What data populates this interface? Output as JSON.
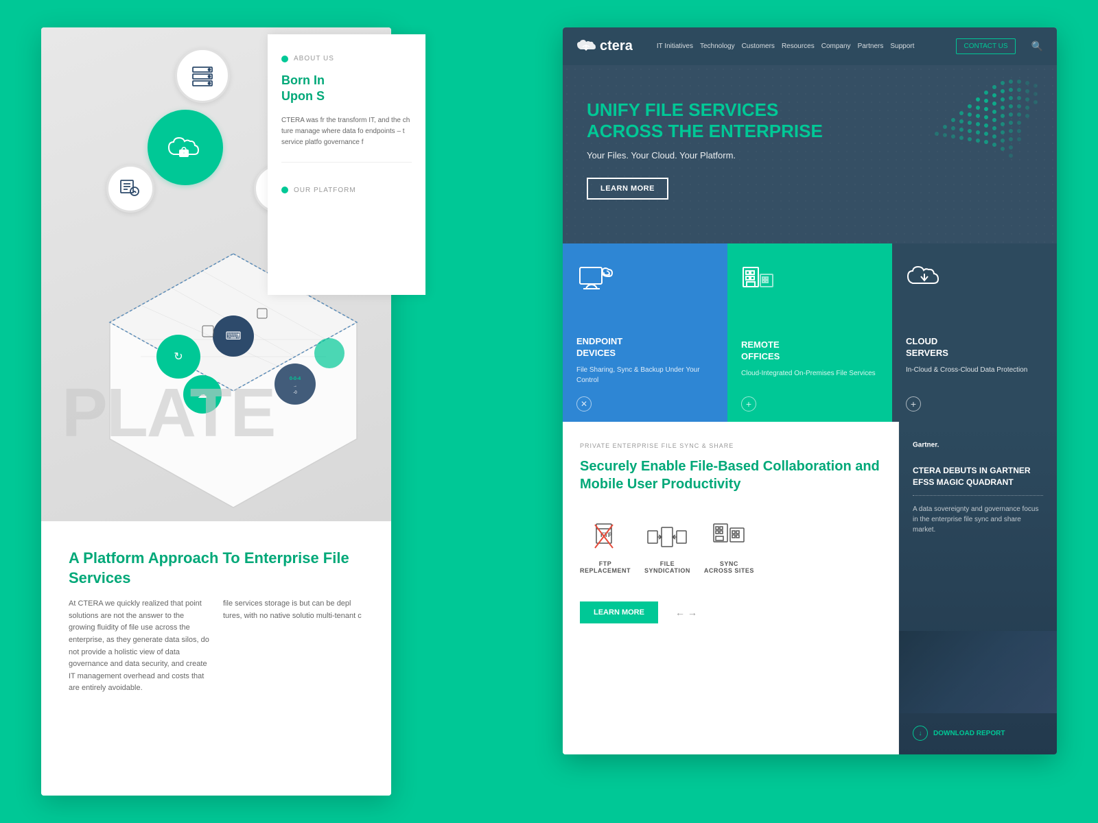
{
  "background": {
    "color": "#00c896"
  },
  "left_panel": {
    "platform_word": "PLATE",
    "bottom_heading": "A Platform Approach To Enterprise File Services",
    "bottom_text1": "At CTERA we quickly realized that point solutions are not the answer to the growing fluidity of file use across the enterprise, as they generate data silos, do not provide a holistic view of data governance and data security, and create IT management overhead and costs that are entirely avoidable.",
    "bottom_text2": "file services storage is but can be depl tures, with no native solutio multi-tenant c"
  },
  "about_panel": {
    "label": "ABOUT US",
    "heading_line1": "Born In",
    "heading_line2": "Upon S",
    "body_text": "CTERA was fr the transform IT, and the ch ture manage where data fo endpoints – t service platfo governance f"
  },
  "nav": {
    "logo": "ctera",
    "links": [
      "IT Initiatives",
      "Technology",
      "Customers",
      "Resources",
      "Company",
      "Partners",
      "Support"
    ],
    "contact_btn": "CONTACT US"
  },
  "hero": {
    "headline_line1": "UNIFY FILE SERVICES",
    "headline_line2": "ACROSS THE ENTERPRISE",
    "subtext": "Your Files. Your Cloud. Your Platform.",
    "cta": "LEARN MORE"
  },
  "cards": [
    {
      "id": "endpoint",
      "title": "ENDPOINT\nDEVICES",
      "description": "File Sharing, Sync & Backup Under Your Control",
      "bg": "blue",
      "action_icon": "x"
    },
    {
      "id": "remote",
      "title": "REMOTE\nOFFICES",
      "description": "Cloud-Integrated On-Premises File Services",
      "bg": "teal",
      "action_icon": "plus"
    },
    {
      "id": "cloud",
      "title": "CLOUD\nSERVERS",
      "description": "In-Cloud & Cross-Cloud Data Protection",
      "bg": "dark",
      "action_icon": "plus"
    }
  ],
  "section_file_sync": {
    "label": "PRIVATE ENTERPRISE FILE SYNC & SHARE",
    "heading": "Securely Enable File-Based Collaboration and Mobile User Productivity",
    "icons": [
      {
        "id": "ftp",
        "label": "FTP\nREPLACEMENT"
      },
      {
        "id": "file_syndication",
        "label": "FILE\nSYNDICATION"
      },
      {
        "id": "sync",
        "label": "SYNC\nACROSS SITES"
      }
    ],
    "cta": "LEARN MORE"
  },
  "section_gartner": {
    "logo": "Gartner.",
    "heading": "CTERA DEBUTS IN GARTNER EFSS MAGIC QUADRANT",
    "body": "A data sovereignty and governance focus in the enterprise file sync and share market.",
    "download": "DOWNLOAD REPORT"
  },
  "our_platform_label": "OUR PLATFORM"
}
